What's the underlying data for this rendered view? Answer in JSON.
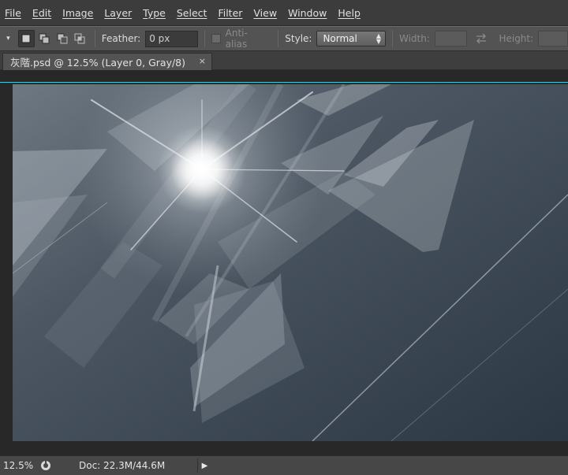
{
  "menu": {
    "items": [
      {
        "label": "File"
      },
      {
        "label": "Edit"
      },
      {
        "label": "Image"
      },
      {
        "label": "Layer"
      },
      {
        "label": "Type"
      },
      {
        "label": "Select"
      },
      {
        "label": "Filter"
      },
      {
        "label": "View"
      },
      {
        "label": "Window"
      },
      {
        "label": "Help"
      }
    ]
  },
  "options": {
    "feather_label": "Feather:",
    "feather_value": "0 px",
    "anti_alias_label": "Anti-alias",
    "style_label": "Style:",
    "style_value": "Normal",
    "width_label": "Width:",
    "height_label": "Height:"
  },
  "document": {
    "tab_title": "灰階.psd @ 12.5% (Layer 0, Gray/8)",
    "close_glyph": "×"
  },
  "status": {
    "zoom": "12.5%",
    "doc_info": "Doc: 22.3M/44.6M"
  },
  "colors": {
    "accent_guide": "#45c8d6",
    "canvas_base": "#2f3a45"
  },
  "icons": {
    "tool_preset": "marquee-dropdown-icon",
    "swap": "swap-arrows-icon",
    "status_menu": "play-arrow-icon"
  }
}
